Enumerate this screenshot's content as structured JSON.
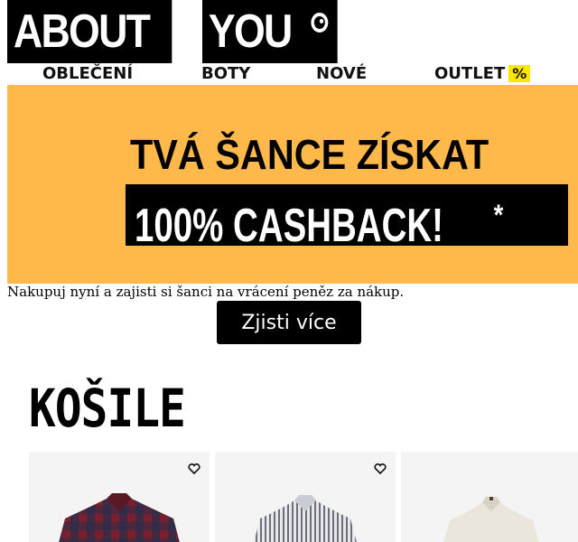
{
  "logo": {
    "part1": "ABOUT",
    "part2": "YOU"
  },
  "nav": {
    "items": [
      {
        "label": "OBLEČENÍ"
      },
      {
        "label": "BOTY"
      },
      {
        "label": "NOVÉ"
      },
      {
        "label": "OUTLET"
      }
    ],
    "outlet_badge": "%"
  },
  "banner": {
    "line1": "TVÁ ŠANCE ZÍSKAT",
    "line2": "100% CASHBACK!",
    "asterisk": "*",
    "background_color": "#ffb84a"
  },
  "promo": {
    "text": "Nakupuj nyní a zajisti si šanci na vrácení peněz za nákup.",
    "cta_label": "Zjisti více"
  },
  "section": {
    "title": "KOŠILE"
  },
  "products": [
    {
      "icon": "heart-icon",
      "image": "red-plaid-shirt"
    },
    {
      "icon": "heart-icon",
      "image": "striped-shirt"
    },
    {
      "image": "white-polo-shirt"
    }
  ],
  "colors": {
    "accent_yellow": "#ffe600",
    "brand_black": "#000000"
  }
}
